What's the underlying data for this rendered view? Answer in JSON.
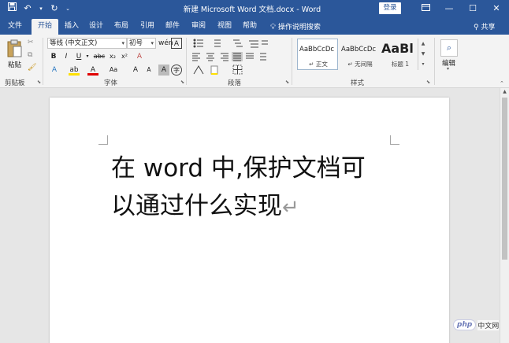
{
  "window": {
    "title": "新建 Microsoft Word 文档.docx - Word",
    "login_label": "登录",
    "controls": [
      "▭",
      "—",
      "☐",
      "✕"
    ]
  },
  "quick_access": {
    "save_icon": "save-icon",
    "undo_icon": "undo-icon",
    "redo_icon": "redo-icon",
    "customize_icon": "chevron-down-icon"
  },
  "tabs": [
    {
      "label": "文件"
    },
    {
      "label": "开始",
      "active": true
    },
    {
      "label": "插入"
    },
    {
      "label": "设计"
    },
    {
      "label": "布局"
    },
    {
      "label": "引用"
    },
    {
      "label": "邮件"
    },
    {
      "label": "审阅"
    },
    {
      "label": "视图"
    },
    {
      "label": "帮助"
    }
  ],
  "tell_me": "操作说明搜索",
  "share": "共享",
  "ribbon": {
    "clipboard": {
      "paste_label": "粘贴",
      "group_label": "剪贴板"
    },
    "font": {
      "font_name": "等线 (中文正文)",
      "font_size": "初号",
      "group_label": "字体",
      "buttons": {
        "grow": "A",
        "shrink": "A",
        "case": "Aa",
        "clear": "A",
        "wen": "wén",
        "border_char": "A",
        "bold": "B",
        "italic": "I",
        "underline": "U",
        "strike": "abc",
        "subscript": "x₂",
        "superscript": "x²",
        "effects": "A",
        "highlight": "ab",
        "font_color": "A",
        "aa": "Aa",
        "a_up": "A",
        "a_down": "A",
        "shade": "A",
        "circle": "字"
      }
    },
    "paragraph": {
      "group_label": "段落"
    },
    "styles": {
      "group_label": "样式",
      "items": [
        {
          "sample": "AaBbCcDc",
          "name": "↵ 正文"
        },
        {
          "sample": "AaBbCcDc",
          "name": "↵ 无间隔"
        },
        {
          "sample": "AaBl",
          "name": "标题 1"
        }
      ]
    },
    "editing": {
      "label": "编辑"
    }
  },
  "document": {
    "line1": "在 word 中,保护文档可",
    "line2": "以通过什么实现",
    "para_mark": "↵"
  },
  "watermark": {
    "logo": "php",
    "text": "中文网"
  }
}
